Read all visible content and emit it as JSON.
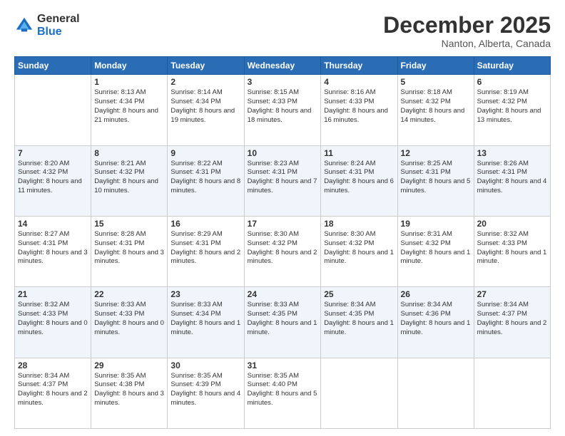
{
  "logo": {
    "general": "General",
    "blue": "Blue"
  },
  "header": {
    "title": "December 2025",
    "location": "Nanton, Alberta, Canada"
  },
  "weekdays": [
    "Sunday",
    "Monday",
    "Tuesday",
    "Wednesday",
    "Thursday",
    "Friday",
    "Saturday"
  ],
  "weeks": [
    [
      {
        "day": "",
        "sunrise": "",
        "sunset": "",
        "daylight": ""
      },
      {
        "day": "1",
        "sunrise": "Sunrise: 8:13 AM",
        "sunset": "Sunset: 4:34 PM",
        "daylight": "Daylight: 8 hours and 21 minutes."
      },
      {
        "day": "2",
        "sunrise": "Sunrise: 8:14 AM",
        "sunset": "Sunset: 4:34 PM",
        "daylight": "Daylight: 8 hours and 19 minutes."
      },
      {
        "day": "3",
        "sunrise": "Sunrise: 8:15 AM",
        "sunset": "Sunset: 4:33 PM",
        "daylight": "Daylight: 8 hours and 18 minutes."
      },
      {
        "day": "4",
        "sunrise": "Sunrise: 8:16 AM",
        "sunset": "Sunset: 4:33 PM",
        "daylight": "Daylight: 8 hours and 16 minutes."
      },
      {
        "day": "5",
        "sunrise": "Sunrise: 8:18 AM",
        "sunset": "Sunset: 4:32 PM",
        "daylight": "Daylight: 8 hours and 14 minutes."
      },
      {
        "day": "6",
        "sunrise": "Sunrise: 8:19 AM",
        "sunset": "Sunset: 4:32 PM",
        "daylight": "Daylight: 8 hours and 13 minutes."
      }
    ],
    [
      {
        "day": "7",
        "sunrise": "Sunrise: 8:20 AM",
        "sunset": "Sunset: 4:32 PM",
        "daylight": "Daylight: 8 hours and 11 minutes."
      },
      {
        "day": "8",
        "sunrise": "Sunrise: 8:21 AM",
        "sunset": "Sunset: 4:32 PM",
        "daylight": "Daylight: 8 hours and 10 minutes."
      },
      {
        "day": "9",
        "sunrise": "Sunrise: 8:22 AM",
        "sunset": "Sunset: 4:31 PM",
        "daylight": "Daylight: 8 hours and 8 minutes."
      },
      {
        "day": "10",
        "sunrise": "Sunrise: 8:23 AM",
        "sunset": "Sunset: 4:31 PM",
        "daylight": "Daylight: 8 hours and 7 minutes."
      },
      {
        "day": "11",
        "sunrise": "Sunrise: 8:24 AM",
        "sunset": "Sunset: 4:31 PM",
        "daylight": "Daylight: 8 hours and 6 minutes."
      },
      {
        "day": "12",
        "sunrise": "Sunrise: 8:25 AM",
        "sunset": "Sunset: 4:31 PM",
        "daylight": "Daylight: 8 hours and 5 minutes."
      },
      {
        "day": "13",
        "sunrise": "Sunrise: 8:26 AM",
        "sunset": "Sunset: 4:31 PM",
        "daylight": "Daylight: 8 hours and 4 minutes."
      }
    ],
    [
      {
        "day": "14",
        "sunrise": "Sunrise: 8:27 AM",
        "sunset": "Sunset: 4:31 PM",
        "daylight": "Daylight: 8 hours and 3 minutes."
      },
      {
        "day": "15",
        "sunrise": "Sunrise: 8:28 AM",
        "sunset": "Sunset: 4:31 PM",
        "daylight": "Daylight: 8 hours and 3 minutes."
      },
      {
        "day": "16",
        "sunrise": "Sunrise: 8:29 AM",
        "sunset": "Sunset: 4:31 PM",
        "daylight": "Daylight: 8 hours and 2 minutes."
      },
      {
        "day": "17",
        "sunrise": "Sunrise: 8:30 AM",
        "sunset": "Sunset: 4:32 PM",
        "daylight": "Daylight: 8 hours and 2 minutes."
      },
      {
        "day": "18",
        "sunrise": "Sunrise: 8:30 AM",
        "sunset": "Sunset: 4:32 PM",
        "daylight": "Daylight: 8 hours and 1 minute."
      },
      {
        "day": "19",
        "sunrise": "Sunrise: 8:31 AM",
        "sunset": "Sunset: 4:32 PM",
        "daylight": "Daylight: 8 hours and 1 minute."
      },
      {
        "day": "20",
        "sunrise": "Sunrise: 8:32 AM",
        "sunset": "Sunset: 4:33 PM",
        "daylight": "Daylight: 8 hours and 1 minute."
      }
    ],
    [
      {
        "day": "21",
        "sunrise": "Sunrise: 8:32 AM",
        "sunset": "Sunset: 4:33 PM",
        "daylight": "Daylight: 8 hours and 0 minutes."
      },
      {
        "day": "22",
        "sunrise": "Sunrise: 8:33 AM",
        "sunset": "Sunset: 4:33 PM",
        "daylight": "Daylight: 8 hours and 0 minutes."
      },
      {
        "day": "23",
        "sunrise": "Sunrise: 8:33 AM",
        "sunset": "Sunset: 4:34 PM",
        "daylight": "Daylight: 8 hours and 1 minute."
      },
      {
        "day": "24",
        "sunrise": "Sunrise: 8:33 AM",
        "sunset": "Sunset: 4:35 PM",
        "daylight": "Daylight: 8 hours and 1 minute."
      },
      {
        "day": "25",
        "sunrise": "Sunrise: 8:34 AM",
        "sunset": "Sunset: 4:35 PM",
        "daylight": "Daylight: 8 hours and 1 minute."
      },
      {
        "day": "26",
        "sunrise": "Sunrise: 8:34 AM",
        "sunset": "Sunset: 4:36 PM",
        "daylight": "Daylight: 8 hours and 1 minute."
      },
      {
        "day": "27",
        "sunrise": "Sunrise: 8:34 AM",
        "sunset": "Sunset: 4:37 PM",
        "daylight": "Daylight: 8 hours and 2 minutes."
      }
    ],
    [
      {
        "day": "28",
        "sunrise": "Sunrise: 8:34 AM",
        "sunset": "Sunset: 4:37 PM",
        "daylight": "Daylight: 8 hours and 2 minutes."
      },
      {
        "day": "29",
        "sunrise": "Sunrise: 8:35 AM",
        "sunset": "Sunset: 4:38 PM",
        "daylight": "Daylight: 8 hours and 3 minutes."
      },
      {
        "day": "30",
        "sunrise": "Sunrise: 8:35 AM",
        "sunset": "Sunset: 4:39 PM",
        "daylight": "Daylight: 8 hours and 4 minutes."
      },
      {
        "day": "31",
        "sunrise": "Sunrise: 8:35 AM",
        "sunset": "Sunset: 4:40 PM",
        "daylight": "Daylight: 8 hours and 5 minutes."
      },
      {
        "day": "",
        "sunrise": "",
        "sunset": "",
        "daylight": ""
      },
      {
        "day": "",
        "sunrise": "",
        "sunset": "",
        "daylight": ""
      },
      {
        "day": "",
        "sunrise": "",
        "sunset": "",
        "daylight": ""
      }
    ]
  ]
}
